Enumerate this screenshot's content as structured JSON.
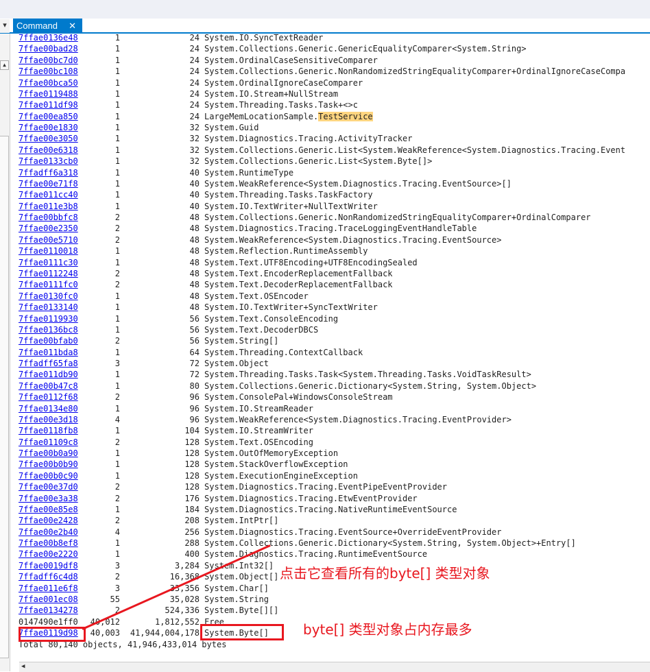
{
  "window": {
    "tab_title": "Command",
    "tab_close": "✕"
  },
  "left_strip": {
    "top_glyph": "▾",
    "button_glyph": "▲"
  },
  "rows": [
    {
      "addr": "7ffae0136e48",
      "count": "1",
      "size": "24",
      "name": "System.IO.SyncTextReader"
    },
    {
      "addr": "7ffae00bad28",
      "count": "1",
      "size": "24",
      "name": "System.Collections.Generic.GenericEqualityComparer<System.String>"
    },
    {
      "addr": "7ffae00bc7d0",
      "count": "1",
      "size": "24",
      "name": "System.OrdinalCaseSensitiveComparer"
    },
    {
      "addr": "7ffae00bc108",
      "count": "1",
      "size": "24",
      "name": "System.Collections.Generic.NonRandomizedStringEqualityComparer+OrdinalIgnoreCaseCompa"
    },
    {
      "addr": "7ffae00bca50",
      "count": "1",
      "size": "24",
      "name": "System.OrdinalIgnoreCaseComparer"
    },
    {
      "addr": "7ffae0119488",
      "count": "1",
      "size": "24",
      "name": "System.IO.Stream+NullStream"
    },
    {
      "addr": "7ffae011df98",
      "count": "1",
      "size": "24",
      "name": "System.Threading.Tasks.Task+<>c"
    },
    {
      "addr": "7ffae00ea850",
      "count": "1",
      "size": "24",
      "name": "LargeMemLocationSample.",
      "name_highlight": "TestService"
    },
    {
      "addr": "7ffae00e1830",
      "count": "1",
      "size": "32",
      "name": "System.Guid"
    },
    {
      "addr": "7ffae00e3050",
      "count": "1",
      "size": "32",
      "name": "System.Diagnostics.Tracing.ActivityTracker"
    },
    {
      "addr": "7ffae00e6318",
      "count": "1",
      "size": "32",
      "name": "System.Collections.Generic.List<System.WeakReference<System.Diagnostics.Tracing.Event"
    },
    {
      "addr": "7ffae0133cb0",
      "count": "1",
      "size": "32",
      "name": "System.Collections.Generic.List<System.Byte[]>"
    },
    {
      "addr": "7ffadff6a318",
      "count": "1",
      "size": "40",
      "name": "System.RuntimeType"
    },
    {
      "addr": "7ffae00e71f8",
      "count": "1",
      "size": "40",
      "name": "System.WeakReference<System.Diagnostics.Tracing.EventSource>[]"
    },
    {
      "addr": "7ffae011cc40",
      "count": "1",
      "size": "40",
      "name": "System.Threading.Tasks.TaskFactory"
    },
    {
      "addr": "7ffae011e3b8",
      "count": "1",
      "size": "40",
      "name": "System.IO.TextWriter+NullTextWriter"
    },
    {
      "addr": "7ffae00bbfc8",
      "count": "2",
      "size": "48",
      "name": "System.Collections.Generic.NonRandomizedStringEqualityComparer+OrdinalComparer"
    },
    {
      "addr": "7ffae00e2350",
      "count": "2",
      "size": "48",
      "name": "System.Diagnostics.Tracing.TraceLoggingEventHandleTable"
    },
    {
      "addr": "7ffae00e5710",
      "count": "2",
      "size": "48",
      "name": "System.WeakReference<System.Diagnostics.Tracing.EventSource>"
    },
    {
      "addr": "7ffae0110018",
      "count": "1",
      "size": "48",
      "name": "System.Reflection.RuntimeAssembly"
    },
    {
      "addr": "7ffae0111c30",
      "count": "1",
      "size": "48",
      "name": "System.Text.UTF8Encoding+UTF8EncodingSealed"
    },
    {
      "addr": "7ffae0112248",
      "count": "2",
      "size": "48",
      "name": "System.Text.EncoderReplacementFallback"
    },
    {
      "addr": "7ffae0111fc0",
      "count": "2",
      "size": "48",
      "name": "System.Text.DecoderReplacementFallback"
    },
    {
      "addr": "7ffae0130fc0",
      "count": "1",
      "size": "48",
      "name": "System.Text.OSEncoder"
    },
    {
      "addr": "7ffae0133140",
      "count": "1",
      "size": "48",
      "name": "System.IO.TextWriter+SyncTextWriter"
    },
    {
      "addr": "7ffae0119930",
      "count": "1",
      "size": "56",
      "name": "System.Text.ConsoleEncoding"
    },
    {
      "addr": "7ffae0136bc8",
      "count": "1",
      "size": "56",
      "name": "System.Text.DecoderDBCS"
    },
    {
      "addr": "7ffae00bfab0",
      "count": "2",
      "size": "56",
      "name": "System.String[]"
    },
    {
      "addr": "7ffae011bda8",
      "count": "1",
      "size": "64",
      "name": "System.Threading.ContextCallback"
    },
    {
      "addr": "7ffadff65fa8",
      "count": "3",
      "size": "72",
      "name": "System.Object"
    },
    {
      "addr": "7ffae011db90",
      "count": "1",
      "size": "72",
      "name": "System.Threading.Tasks.Task<System.Threading.Tasks.VoidTaskResult>"
    },
    {
      "addr": "7ffae00b47c8",
      "count": "1",
      "size": "80",
      "name": "System.Collections.Generic.Dictionary<System.String, System.Object>"
    },
    {
      "addr": "7ffae0112f68",
      "count": "2",
      "size": "96",
      "name": "System.ConsolePal+WindowsConsoleStream"
    },
    {
      "addr": "7ffae0134e80",
      "count": "1",
      "size": "96",
      "name": "System.IO.StreamReader"
    },
    {
      "addr": "7ffae00e3d18",
      "count": "4",
      "size": "96",
      "name": "System.WeakReference<System.Diagnostics.Tracing.EventProvider>"
    },
    {
      "addr": "7ffae0118fb8",
      "count": "1",
      "size": "104",
      "name": "System.IO.StreamWriter"
    },
    {
      "addr": "7ffae01109c8",
      "count": "2",
      "size": "128",
      "name": "System.Text.OSEncoding"
    },
    {
      "addr": "7ffae00b0a90",
      "count": "1",
      "size": "128",
      "name": "System.OutOfMemoryException"
    },
    {
      "addr": "7ffae00b0b90",
      "count": "1",
      "size": "128",
      "name": "System.StackOverflowException"
    },
    {
      "addr": "7ffae00b0c90",
      "count": "1",
      "size": "128",
      "name": "System.ExecutionEngineException"
    },
    {
      "addr": "7ffae00e37d0",
      "count": "2",
      "size": "128",
      "name": "System.Diagnostics.Tracing.EventPipeEventProvider"
    },
    {
      "addr": "7ffae00e3a38",
      "count": "2",
      "size": "176",
      "name": "System.Diagnostics.Tracing.EtwEventProvider"
    },
    {
      "addr": "7ffae00e85e8",
      "count": "1",
      "size": "184",
      "name": "System.Diagnostics.Tracing.NativeRuntimeEventSource"
    },
    {
      "addr": "7ffae00e2428",
      "count": "2",
      "size": "208",
      "name": "System.IntPtr[]"
    },
    {
      "addr": "7ffae00e2b40",
      "count": "4",
      "size": "256",
      "name": "System.Diagnostics.Tracing.EventSource+OverrideEventProvider"
    },
    {
      "addr": "7ffae00b8ef8",
      "count": "1",
      "size": "288",
      "name": "System.Collections.Generic.Dictionary<System.String, System.Object>+Entry[]"
    },
    {
      "addr": "7ffae00e2220",
      "count": "1",
      "size": "400",
      "name": "System.Diagnostics.Tracing.RuntimeEventSource"
    },
    {
      "addr": "7ffae0019df8",
      "count": "3",
      "size": "3,284",
      "name": "System.Int32[]"
    },
    {
      "addr": "7ffadff6c4d8",
      "count": "2",
      "size": "16,368",
      "name": "System.Object[]"
    },
    {
      "addr": "7ffae011e6f8",
      "count": "3",
      "size": "33,356",
      "name": "System.Char[]"
    },
    {
      "addr": "7ffae001ec08",
      "count": "55",
      "size": "35,028",
      "name": "System.String"
    },
    {
      "addr": "7ffae0134278",
      "count": "2",
      "size": "524,336",
      "name": "System.Byte[][]"
    },
    {
      "addr": "0147490e1ff0",
      "count": "40,012",
      "size": "1,812,552",
      "name": "Free",
      "plain_addr": true
    },
    {
      "addr": "7ffae0119d98",
      "count": "40,003",
      "size": "41,944,004,178",
      "name": "System.Byte[]"
    }
  ],
  "total_line": "Total 80,140 objects, 41,946,433,014 bytes",
  "annotations": {
    "click_note": "点击它查看所有的byte[] 类型对象",
    "most_memory_note": "byte[] 类型对象占内存最多"
  },
  "scrollbar": {
    "left_arrow": "◀"
  }
}
